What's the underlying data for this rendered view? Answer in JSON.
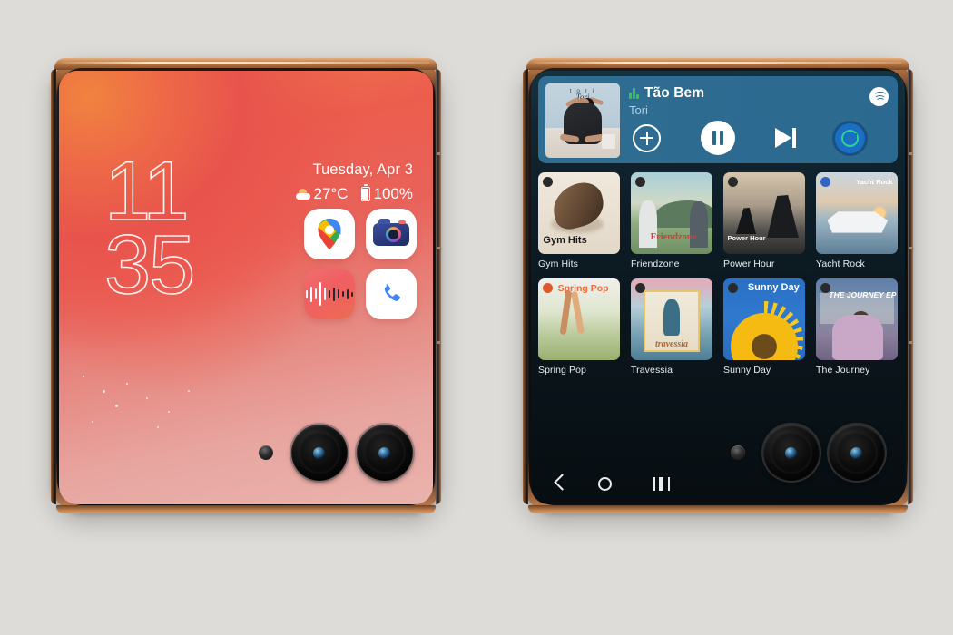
{
  "page": {
    "background_color": "#dedcd8",
    "description": "Two foldable phone renders side by side — cover screen and inner screen"
  },
  "left_phone": {
    "name": "cover-screen-phone",
    "frame_color": "#b4764a",
    "wallpaper_colors": [
      "#ef7c4b",
      "#ec5d4d",
      "#eab3ad"
    ],
    "clock": {
      "hours": "11",
      "minutes": "35"
    },
    "status": {
      "date": "Tuesday, Apr 3",
      "temperature": "27°C",
      "weather_icon": "partly-cloudy-icon",
      "battery": "100%",
      "battery_icon": "battery-full-icon"
    },
    "apps": [
      {
        "name": "maps-app-icon",
        "label": "Maps"
      },
      {
        "name": "camera-app-icon",
        "label": "Camera"
      },
      {
        "name": "recorder-app-icon",
        "label": "Recorder"
      },
      {
        "name": "phone-app-icon",
        "label": "Phone"
      }
    ],
    "hardware": {
      "flash": "led-flash",
      "lens_count": 2
    }
  },
  "right_phone": {
    "name": "inner-screen-phone",
    "frame_color": "#b4764a",
    "screen_background": "#0a151b",
    "player": {
      "accent_color": "#2b6990",
      "track_title": "Tão Bem",
      "artist": "Tori",
      "source_icon": "spotify-icon",
      "playing_indicator_icon": "equalizer-icon",
      "album_art": {
        "caption": "t o r i",
        "signature": "Tori"
      },
      "controls": [
        {
          "name": "add-to-library-button",
          "icon": "plus-circle-icon",
          "label": "Add"
        },
        {
          "name": "pause-button",
          "icon": "pause-icon",
          "label": "Pause"
        },
        {
          "name": "next-track-button",
          "icon": "skip-next-icon",
          "label": "Next"
        },
        {
          "name": "connect-device-button",
          "icon": "cast-device-icon",
          "label": "Connect to a device"
        }
      ]
    },
    "playlists": [
      {
        "label": "Gym Hits",
        "art_text": "Gym Hits",
        "badge": "dark"
      },
      {
        "label": "Friendzone",
        "art_text": "Friendzone",
        "badge": "dark"
      },
      {
        "label": "Power Hour",
        "art_text": "Power Hour",
        "badge": "dark"
      },
      {
        "label": "Yacht Rock",
        "art_text": "Yacht Rock",
        "badge": "blue"
      },
      {
        "label": "Spring Pop",
        "art_text": "Spring Pop",
        "badge": "orange"
      },
      {
        "label": "Travessia",
        "art_text": "travessia",
        "badge": "dark"
      },
      {
        "label": "Sunny Day",
        "art_text": "Sunny Day",
        "badge": "dark"
      },
      {
        "label": "The Journey",
        "art_text": "THE JOURNEY EP",
        "badge": "dark"
      }
    ],
    "navbar": [
      {
        "name": "nav-back-button",
        "icon": "chevron-left-icon",
        "label": "Back"
      },
      {
        "name": "nav-home-button",
        "icon": "circle-icon",
        "label": "Home"
      },
      {
        "name": "nav-recents-button",
        "icon": "recents-icon",
        "label": "Recents"
      }
    ],
    "hardware": {
      "flash": "led-flash",
      "lens_count": 2
    }
  }
}
